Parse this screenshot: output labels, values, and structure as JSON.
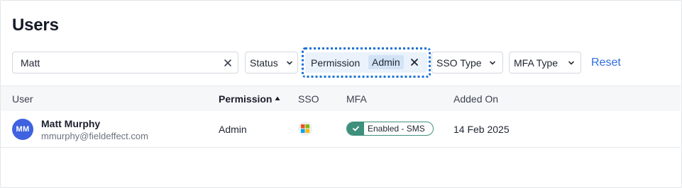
{
  "page": {
    "title": "Users"
  },
  "filters": {
    "search": {
      "value": "Matt",
      "placeholder": ""
    },
    "status_label": "Status",
    "permission": {
      "label": "Permission",
      "value": "Admin"
    },
    "sso_type_label": "SSO Type",
    "mfa_type_label": "MFA Type",
    "reset_label": "Reset"
  },
  "table": {
    "columns": [
      "User",
      "Permission",
      "SSO",
      "MFA",
      "Added On"
    ],
    "sorted_column": "Permission",
    "sort_direction": "ascending",
    "rows": [
      {
        "initials": "MM",
        "name": "Matt Murphy",
        "email": "mmurphy@fieldeffect.com",
        "permission": "Admin",
        "sso_icon": "microsoft-icon",
        "mfa": "Enabled - SMS",
        "added_on": "14 Feb 2025"
      }
    ]
  },
  "colors": {
    "accent": "#2f6ede",
    "focus_ring": "#1a72d8",
    "avatar": "#3e62e0",
    "mfa_enabled": "#3e8f7b"
  }
}
